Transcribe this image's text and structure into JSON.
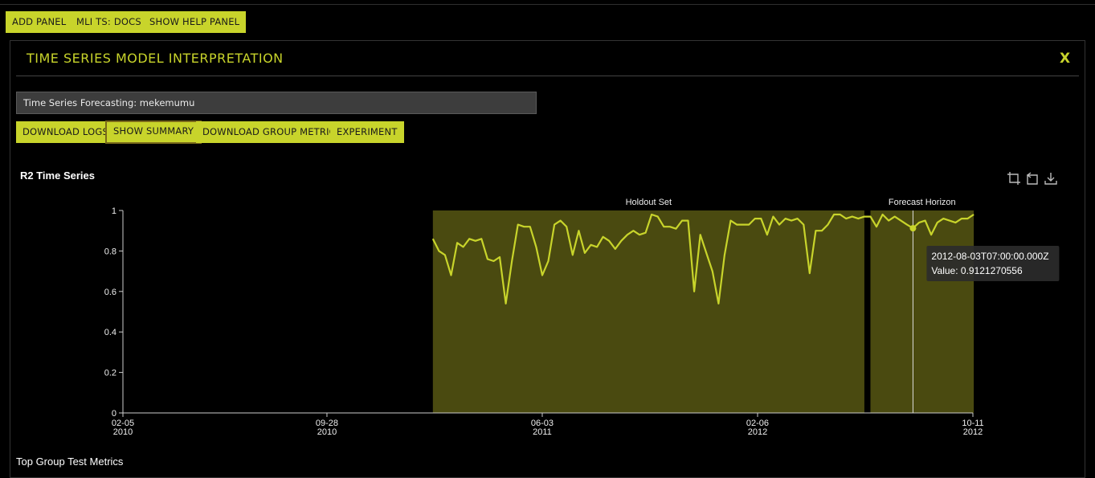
{
  "toolbar": {
    "add_panel": "ADD PANEL",
    "mli_docs": "MLI TS: DOCS",
    "show_help": "SHOW HELP PANEL"
  },
  "panel": {
    "title": "TIME SERIES MODEL INTERPRETATION",
    "close": "X",
    "model_value": "Time Series Forecasting: mekemumu",
    "actions": {
      "download_logs": "DOWNLOAD LOGS",
      "show_summary": "SHOW SUMMARY",
      "download_group_metrics": "DOWNLOAD GROUP METRICS",
      "experiment": "EXPERIMENT"
    },
    "section_title": "Top Group Test Metrics"
  },
  "icons": [
    "crop-icon",
    "reset-zoom-icon",
    "download-icon"
  ],
  "colors": {
    "accent": "#c8d42b",
    "region_fill": "#4a4a10",
    "background": "#000000"
  },
  "chart_data": {
    "type": "line",
    "title": "R2 Time Series",
    "ylim": [
      0,
      1
    ],
    "yticks": [
      "0",
      "0.2",
      "0.4",
      "0.6",
      "0.8",
      "1"
    ],
    "xticks": [
      {
        "date": "2010-02-05",
        "line1": "02-05",
        "line2": "2010"
      },
      {
        "date": "2010-09-28",
        "line1": "09-28",
        "line2": "2010"
      },
      {
        "date": "2011-06-03",
        "line1": "06-03",
        "line2": "2011"
      },
      {
        "date": "2012-02-06",
        "line1": "02-06",
        "line2": "2012"
      },
      {
        "date": "2012-10-11",
        "line1": "10-11",
        "line2": "2012"
      }
    ],
    "regions": [
      {
        "label": "Holdout Set",
        "start": "2011-01-28",
        "end": "2012-06-08"
      },
      {
        "label": "Forecast Horizon",
        "start": "2012-06-15",
        "end": "2012-10-12"
      }
    ],
    "series": [
      {
        "x": [
          "2011-01-28",
          "2011-02-04",
          "2011-02-11",
          "2011-02-18",
          "2011-02-25",
          "2011-03-04",
          "2011-03-11",
          "2011-03-18",
          "2011-03-25",
          "2011-04-01",
          "2011-04-08",
          "2011-04-15",
          "2011-04-22",
          "2011-04-29",
          "2011-05-06",
          "2011-05-13",
          "2011-05-20",
          "2011-05-27",
          "2011-06-03",
          "2011-06-10",
          "2011-06-17",
          "2011-06-24",
          "2011-07-01",
          "2011-07-08",
          "2011-07-15",
          "2011-07-22",
          "2011-07-29",
          "2011-08-05",
          "2011-08-12",
          "2011-08-19",
          "2011-08-26",
          "2011-09-02",
          "2011-09-09",
          "2011-09-16",
          "2011-09-23",
          "2011-09-30",
          "2011-10-07",
          "2011-10-14",
          "2011-10-21",
          "2011-10-28",
          "2011-11-04",
          "2011-11-11",
          "2011-11-18",
          "2011-11-25",
          "2011-12-02",
          "2011-12-09",
          "2011-12-16",
          "2011-12-23",
          "2011-12-30",
          "2012-01-06",
          "2012-01-13",
          "2012-01-20",
          "2012-01-27",
          "2012-02-03",
          "2012-02-10",
          "2012-02-17",
          "2012-02-24",
          "2012-03-02",
          "2012-03-09",
          "2012-03-16",
          "2012-03-23",
          "2012-03-30",
          "2012-04-06",
          "2012-04-13",
          "2012-04-20",
          "2012-04-27",
          "2012-05-04",
          "2012-05-11",
          "2012-05-18",
          "2012-05-25",
          "2012-06-01",
          "2012-06-08",
          "2012-06-15",
          "2012-06-22",
          "2012-06-29",
          "2012-07-06",
          "2012-07-13",
          "2012-07-20",
          "2012-07-27",
          "2012-08-03",
          "2012-08-10",
          "2012-08-17",
          "2012-08-24",
          "2012-08-31",
          "2012-09-07",
          "2012-09-14",
          "2012-09-21",
          "2012-09-28",
          "2012-10-05",
          "2012-10-12"
        ],
        "y": [
          0.86,
          0.8,
          0.78,
          0.68,
          0.84,
          0.82,
          0.86,
          0.85,
          0.86,
          0.76,
          0.75,
          0.77,
          0.54,
          0.75,
          0.93,
          0.92,
          0.92,
          0.82,
          0.68,
          0.75,
          0.93,
          0.95,
          0.92,
          0.78,
          0.9,
          0.79,
          0.83,
          0.82,
          0.87,
          0.85,
          0.81,
          0.85,
          0.88,
          0.9,
          0.88,
          0.89,
          0.98,
          0.97,
          0.92,
          0.92,
          0.91,
          0.95,
          0.95,
          0.6,
          0.88,
          0.79,
          0.7,
          0.54,
          0.78,
          0.95,
          0.93,
          0.93,
          0.93,
          0.96,
          0.96,
          0.88,
          0.97,
          0.93,
          0.96,
          0.95,
          0.96,
          0.93,
          0.69,
          0.9,
          0.9,
          0.93,
          0.98,
          0.98,
          0.96,
          0.97,
          0.96,
          0.97,
          0.97,
          0.92,
          0.98,
          0.95,
          0.97,
          0.95,
          0.93,
          0.9121270556,
          0.94,
          0.95,
          0.88,
          0.94,
          0.96,
          0.95,
          0.94,
          0.96,
          0.96,
          0.98
        ]
      }
    ],
    "tooltip": {
      "line1": "2012-08-03T07:00:00.000Z",
      "line2": "Value: 0.9121270556",
      "date": "2012-08-03",
      "value": 0.9121270556
    }
  }
}
